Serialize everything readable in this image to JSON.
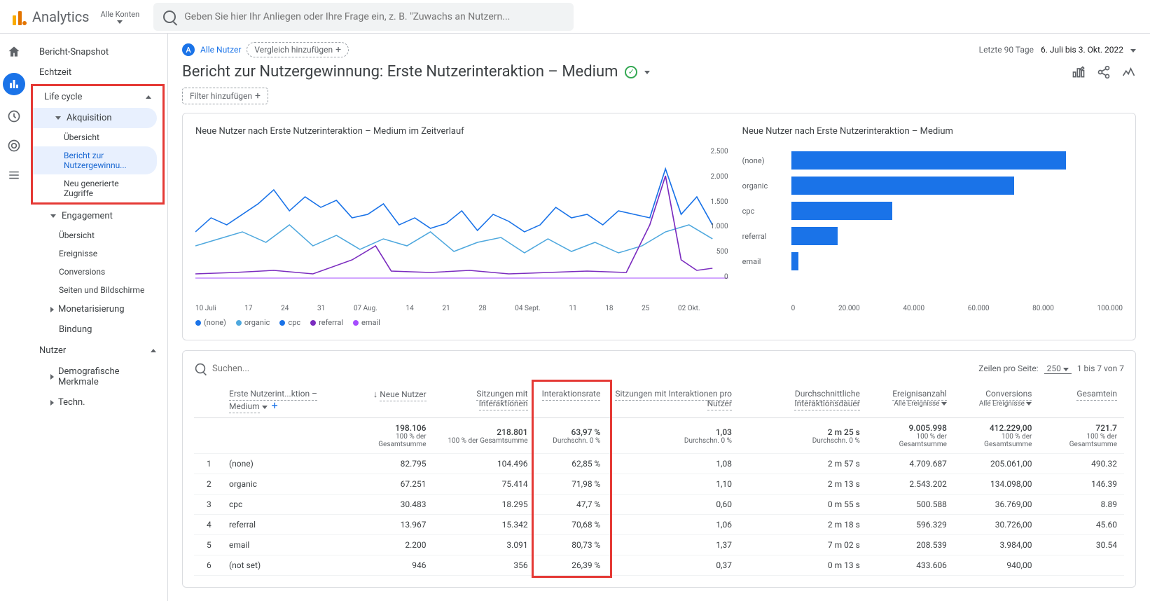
{
  "header": {
    "product": "Analytics",
    "account_selector": "Alle Konten",
    "search_placeholder": "Geben Sie hier Ihr Anliegen oder Ihre Frage ein, z. B. \"Zuwachs an Nutzern..."
  },
  "sidebar": {
    "snapshot": "Bericht-Snapshot",
    "realtime": "Echtzeit",
    "lifecycle": "Life cycle",
    "acquisition": "Akquisition",
    "acq_overview": "Übersicht",
    "acq_report": "Bericht zur Nutzergewinnu...",
    "acq_traffic": "Neu generierte Zugriffe",
    "engagement": "Engagement",
    "eng_overview": "Übersicht",
    "eng_events": "Ereignisse",
    "eng_conversions": "Conversions",
    "eng_pages": "Seiten und Bildschirme",
    "monetization": "Monetarisierung",
    "retention": "Bindung",
    "user": "Nutzer",
    "demographics": "Demografische Merkmale",
    "tech": "Techn."
  },
  "topbar": {
    "all_users": "Alle Nutzer",
    "add_comparison": "Vergleich hinzufügen",
    "date_label": "Letzte 90 Tage",
    "date_range": "6. Juli bis 3. Okt. 2022"
  },
  "report": {
    "title": "Bericht zur Nutzergewinnung: Erste Nutzerinteraktion – Medium",
    "filter_add": "Filter hinzufügen"
  },
  "chart_data": [
    {
      "type": "line",
      "title": "Neue Nutzer nach Erste Nutzerinteraktion – Medium im Zeitverlauf",
      "ylim": [
        0,
        2500
      ],
      "yticks": [
        "2.500",
        "2.000",
        "1.500",
        "1.000",
        "500",
        "0"
      ],
      "xticks": [
        "10 Juli",
        "17",
        "24",
        "31",
        "07 Aug.",
        "14",
        "21",
        "28",
        "04 Sept.",
        "11",
        "18",
        "25",
        "02 Okt."
      ],
      "series": [
        {
          "name": "(none)",
          "color": "#1a73e8"
        },
        {
          "name": "organic",
          "color": "#4ea8de"
        },
        {
          "name": "cpc",
          "color": "#1a73e8"
        },
        {
          "name": "referral",
          "color": "#7b2cbf"
        },
        {
          "name": "email",
          "color": "#a64dff"
        }
      ]
    },
    {
      "type": "bar",
      "title": "Neue Nutzer nach Erste Nutzerinteraktion – Medium",
      "xlim": [
        0,
        100000
      ],
      "xticks": [
        "0",
        "20.000",
        "40.000",
        "60.000",
        "80.000",
        "100.000"
      ],
      "categories": [
        "(none)",
        "organic",
        "cpc",
        "referral",
        "email"
      ],
      "values": [
        82795,
        67251,
        30483,
        13967,
        2200
      ]
    }
  ],
  "table": {
    "search_placeholder": "Suchen...",
    "rows_per_page_label": "Zeilen pro Seite:",
    "rows_per_page": "250",
    "range": "1 bis 7 von 7",
    "dimension": "Erste Nutzerint...ktion – Medium",
    "columns": {
      "new_users": "Neue Nutzer",
      "sessions": "Sitzungen mit Interaktionen",
      "engagement_rate": "Interaktionsrate",
      "sessions_per_user": "Sitzungen mit Interaktionen pro Nutzer",
      "avg_duration": "Durchschnittliche Interaktionsdauer",
      "event_count": "Ereignisanzahl",
      "event_sub": "Alle Ereignisse",
      "conversions": "Conversions",
      "conversions_sub": "Alle Ereignisse",
      "total_revenue": "Gesamtein"
    },
    "totals": {
      "new_users": "198.106",
      "sessions": "218.801",
      "engagement_rate": "63,97 %",
      "sessions_per_user": "1,03",
      "avg_duration": "2 m 25 s",
      "event_count": "9.005.998",
      "conversions": "412.229,00",
      "total_revenue": "721.7",
      "pct": "100 % der Gesamtsumme",
      "avg_pct": "Durchschn. 0 %"
    },
    "rows": [
      {
        "idx": "1",
        "medium": "(none)",
        "new_users": "82.795",
        "sessions": "104.496",
        "rate": "62,85 %",
        "spu": "1,08",
        "dur": "2 m 57 s",
        "events": "4.709.687",
        "conv": "205.061,00",
        "rev": "490.32"
      },
      {
        "idx": "2",
        "medium": "organic",
        "new_users": "67.251",
        "sessions": "75.414",
        "rate": "71,98 %",
        "spu": "1,10",
        "dur": "2 m 13 s",
        "events": "2.543.202",
        "conv": "134.098,00",
        "rev": "146.39"
      },
      {
        "idx": "3",
        "medium": "cpc",
        "new_users": "30.483",
        "sessions": "18.295",
        "rate": "47,7 %",
        "spu": "0,60",
        "dur": "0 m 55 s",
        "events": "500.588",
        "conv": "36.769,00",
        "rev": "8.89"
      },
      {
        "idx": "4",
        "medium": "referral",
        "new_users": "13.967",
        "sessions": "15.342",
        "rate": "70,68 %",
        "spu": "1,06",
        "dur": "2 m 18 s",
        "events": "596.329",
        "conv": "30.726,00",
        "rev": "45.60"
      },
      {
        "idx": "5",
        "medium": "email",
        "new_users": "2.200",
        "sessions": "3.091",
        "rate": "80,73 %",
        "spu": "1,37",
        "dur": "7 m 02 s",
        "events": "208.539",
        "conv": "3.984,00",
        "rev": "30.54"
      },
      {
        "idx": "6",
        "medium": "(not set)",
        "new_users": "946",
        "sessions": "356",
        "rate": "26,39 %",
        "spu": "0,37",
        "dur": "0 m 13 s",
        "events": "433.606",
        "conv": "940,00",
        "rev": ""
      }
    ]
  }
}
